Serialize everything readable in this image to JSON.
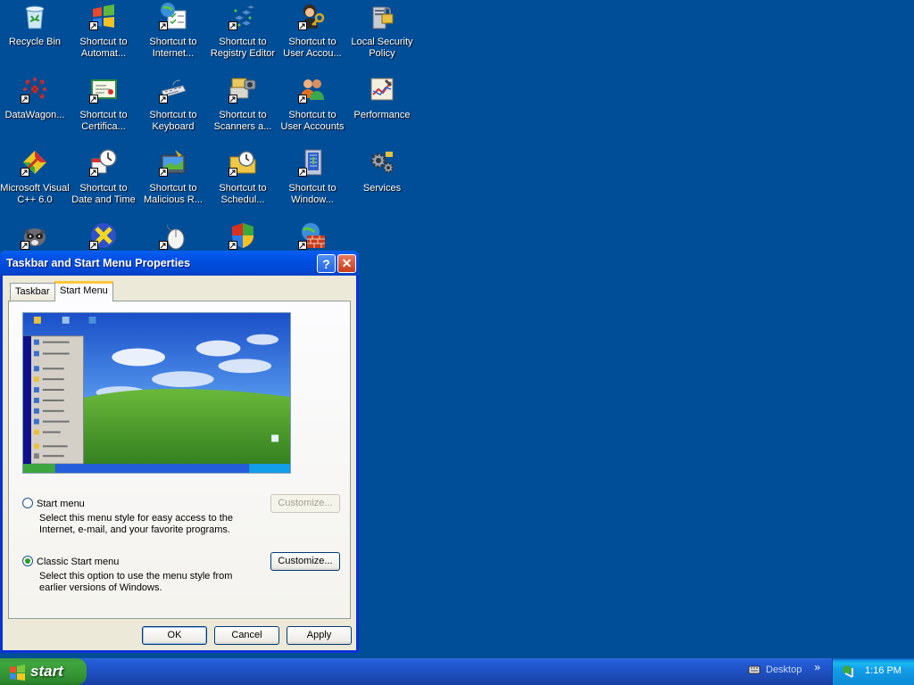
{
  "desktop": {
    "icons": [
      {
        "label": "Recycle Bin",
        "icon": "recycle-bin-icon"
      },
      {
        "label": "Shortcut to\nAutomat...",
        "icon": "windows-flag-icon"
      },
      {
        "label": "Shortcut to\nInternet...",
        "icon": "internet-options-icon"
      },
      {
        "label": "Shortcut to\nRegistry Editor",
        "icon": "registry-editor-icon"
      },
      {
        "label": "Shortcut to\nUser Accou...",
        "icon": "user-accounts-key-icon"
      },
      {
        "label": "Local Security\nPolicy",
        "icon": "security-policy-icon"
      },
      {
        "label": "DataWagon...",
        "icon": "datawagon-icon"
      },
      {
        "label": "Shortcut to\nCertifica...",
        "icon": "certificate-icon"
      },
      {
        "label": "Shortcut to\nKeyboard",
        "icon": "keyboard-icon"
      },
      {
        "label": "Shortcut to\nScanners a...",
        "icon": "scanner-icon"
      },
      {
        "label": "Shortcut to\nUser Accounts",
        "icon": "user-accounts-icon"
      },
      {
        "label": "Performance",
        "icon": "performance-icon"
      },
      {
        "label": "Microsoft Visual\nC++ 6.0",
        "icon": "visual-cpp-icon"
      },
      {
        "label": "Shortcut to\nDate and Time",
        "icon": "date-time-icon"
      },
      {
        "label": "Shortcut to\nMalicious R...",
        "icon": "malicious-removal-icon"
      },
      {
        "label": "Shortcut to\nSchedul...",
        "icon": "scheduled-tasks-icon"
      },
      {
        "label": "Shortcut to\nWindow...",
        "icon": "windows-update-icon"
      },
      {
        "label": "Services",
        "icon": "services-icon"
      },
      {
        "label": "",
        "icon": "raccoon-icon"
      },
      {
        "label": "",
        "icon": "x-app-icon"
      },
      {
        "label": "",
        "icon": "mouse-icon"
      },
      {
        "label": "",
        "icon": "security-shield-icon"
      },
      {
        "label": "",
        "icon": "firewall-icon"
      }
    ]
  },
  "dialog": {
    "title": "Taskbar and Start Menu Properties",
    "help_glyph": "?",
    "close_glyph": "✕",
    "tabs": [
      {
        "label": "Taskbar",
        "active": false
      },
      {
        "label": "Start Menu",
        "active": true
      }
    ],
    "options": [
      {
        "label": "Start menu",
        "description": "Select this menu style for easy access to the Internet, e-mail, and your favorite programs.",
        "selected": false,
        "customize_label": "Customize...",
        "customize_enabled": false
      },
      {
        "label": "Classic Start menu",
        "description": "Select this option to use the menu style from earlier versions of Windows.",
        "selected": true,
        "customize_label": "Customize...",
        "customize_enabled": true
      }
    ],
    "buttons": {
      "ok": "OK",
      "cancel": "Cancel",
      "apply": "Apply"
    }
  },
  "taskbar": {
    "start_label": "start",
    "toolbar_label": "Desktop",
    "toolbar_chevron": "»",
    "clock": "1:16 PM"
  },
  "colors": {
    "desktop": "#004e98",
    "title_bar": "#0052e6",
    "taskbar": "#245edb",
    "start_button": "#3ea63e",
    "dialog_face": "#ece9d8"
  }
}
